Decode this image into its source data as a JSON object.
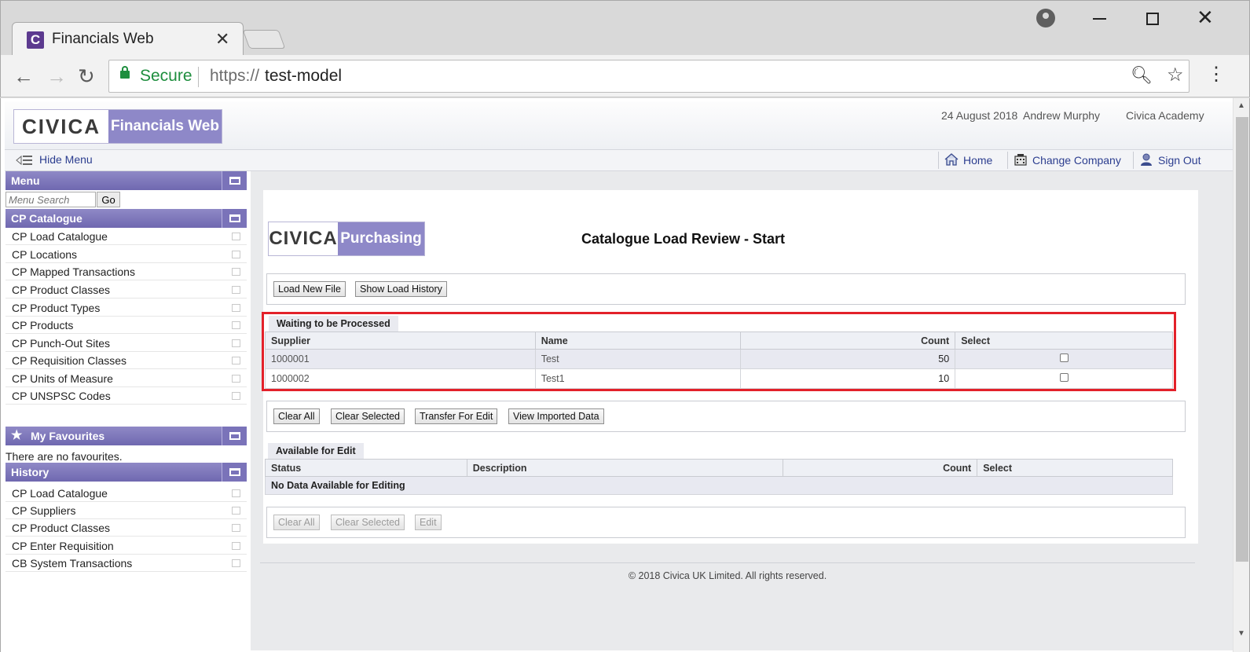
{
  "browser": {
    "tab_title": "Financials Web",
    "tab_favicon_letter": "C",
    "security_label": "Secure",
    "url_scheme": "https://",
    "url_host": "test-model"
  },
  "header": {
    "logo_brand": "CIVICA",
    "logo_app": "Financials Web",
    "date": "24 August 2018",
    "user": "Andrew Murphy",
    "organisation": "Civica Academy",
    "hide_menu_label": "Hide Menu",
    "home_label": "Home",
    "change_company_label": "Change Company",
    "sign_out_label": "Sign Out"
  },
  "sidebar": {
    "menu_title": "Menu",
    "search_placeholder": "Menu Search",
    "search_go": "Go",
    "catalogue_title": "CP Catalogue",
    "catalogue_items": [
      "CP Load Catalogue",
      "CP Locations",
      "CP Mapped Transactions",
      "CP Product Classes",
      "CP Product Types",
      "CP Products",
      "CP Punch-Out Sites",
      "CP Requisition Classes",
      "CP Units of Measure",
      "CP UNSPSC Codes"
    ],
    "favourites_title": "My Favourites",
    "no_favourites": "There are no favourites.",
    "history_title": "History",
    "history_items": [
      "CP Load Catalogue",
      "CP Suppliers",
      "CP Product Classes",
      "CP Enter Requisition",
      "CB System Transactions"
    ]
  },
  "main": {
    "logo_brand": "CIVICA",
    "logo_module": "Purchasing",
    "page_title": "Catalogue Load Review - Start",
    "top_buttons": {
      "load_new_file": "Load New File",
      "show_load_history": "Show Load History"
    },
    "waiting": {
      "tab_label": "Waiting to be Processed",
      "columns": {
        "supplier": "Supplier",
        "name": "Name",
        "count": "Count",
        "select": "Select"
      },
      "rows": [
        {
          "supplier": "1000001",
          "name": "Test",
          "count": "50"
        },
        {
          "supplier": "1000002",
          "name": "Test1",
          "count": "10"
        }
      ]
    },
    "waiting_buttons": {
      "clear_all": "Clear All",
      "clear_selected": "Clear Selected",
      "transfer_for_edit": "Transfer For Edit",
      "view_imported_data": "View Imported Data"
    },
    "available": {
      "tab_label": "Available for Edit",
      "columns": {
        "status": "Status",
        "description": "Description",
        "count": "Count",
        "select": "Select"
      },
      "empty_message": "No Data Available for Editing"
    },
    "available_buttons": {
      "clear_all": "Clear All",
      "clear_selected": "Clear Selected",
      "edit": "Edit"
    },
    "footer": "© 2018 Civica UK Limited. All rights reserved."
  },
  "colors": {
    "accent": "#8e88c8",
    "highlight": "#e3212a",
    "link": "#2b3d8f",
    "secure": "#1e8e3e"
  }
}
